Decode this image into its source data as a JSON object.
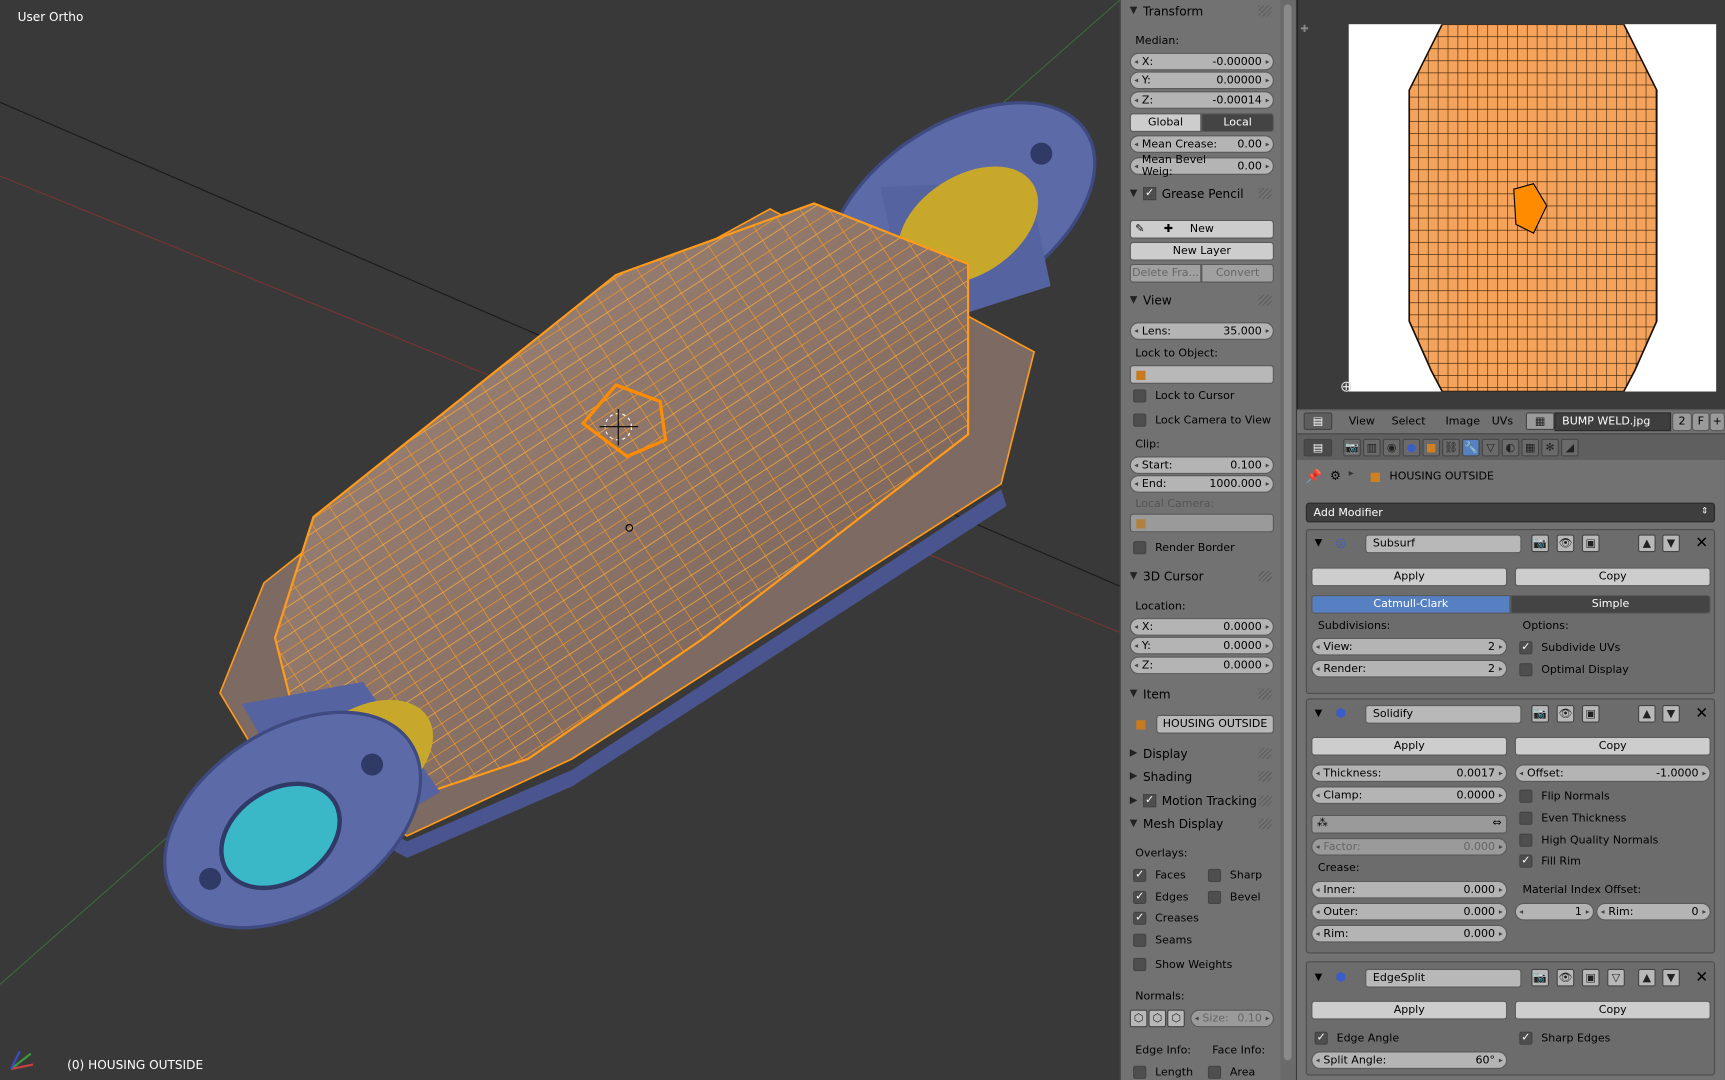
{
  "viewport": {
    "title": "User Ortho",
    "status": "(0) HOUSING OUTSIDE"
  },
  "npanel": {
    "transform": {
      "title": "Transform",
      "median_label": "Median:",
      "x_label": "X:",
      "x": "-0.00000",
      "y_label": "Y:",
      "y": "0.00000",
      "z_label": "Z:",
      "z": "-0.00014",
      "global": "Global",
      "local": "Local",
      "crease_label": "Mean Crease:",
      "crease": "0.00",
      "bevel_label": "Mean Bevel Weig:",
      "bevel": "0.00"
    },
    "grease": {
      "title": "Grease Pencil",
      "new": "New",
      "new_layer": "New Layer",
      "delete": "Delete Fra...",
      "convert": "Convert"
    },
    "view": {
      "title": "View",
      "lens_label": "Lens:",
      "lens": "35.000",
      "lock_obj": "Lock to Object:",
      "lock_cursor": "Lock to Cursor",
      "lock_camera": "Lock Camera to View",
      "clip": "Clip:",
      "start_label": "Start:",
      "start": "0.100",
      "end_label": "End:",
      "end": "1000.000",
      "local_camera": "Local Camera:",
      "render_border": "Render Border"
    },
    "cursor": {
      "title": "3D Cursor",
      "location": "Location:",
      "x_label": "X:",
      "x": "0.0000",
      "y_label": "Y:",
      "y": "0.0000",
      "z_label": "Z:",
      "z": "0.0000"
    },
    "item": {
      "title": "Item",
      "name": "HOUSING OUTSIDE"
    },
    "display": "Display",
    "shading": "Shading",
    "motion": "Motion Tracking",
    "mesh": {
      "title": "Mesh Display",
      "overlays": "Overlays:",
      "faces": "Faces",
      "sharp": "Sharp",
      "edges": "Edges",
      "bevel": "Bevel",
      "creases": "Creases",
      "seams": "Seams",
      "weights": "Show Weights",
      "normals": "Normals:",
      "size_label": "Size:",
      "size": "0.10",
      "edge_info": "Edge Info:",
      "face_info": "Face Info:",
      "length": "Length",
      "area": "Area"
    }
  },
  "image_editor": {
    "menu": [
      "View",
      "Select",
      "Image",
      "UVs"
    ],
    "image_name": "BUMP WELD.jpg",
    "users": "2",
    "fake": "F"
  },
  "props": {
    "object": "HOUSING OUTSIDE",
    "add_modifier": "Add Modifier",
    "subsurf": {
      "name": "Subsurf",
      "apply": "Apply",
      "copy": "Copy",
      "catmull": "Catmull-Clark",
      "simple": "Simple",
      "subdivisions": "Subdivisions:",
      "view_label": "View:",
      "view": "2",
      "render_label": "Render:",
      "render": "2",
      "options": "Options:",
      "subdivide_uvs": "Subdivide UVs",
      "optimal": "Optimal Display"
    },
    "solidify": {
      "name": "Solidify",
      "apply": "Apply",
      "copy": "Copy",
      "thickness_label": "Thickness:",
      "thickness": "0.0017",
      "offset_label": "Offset:",
      "offset": "-1.0000",
      "clamp_label": "Clamp:",
      "clamp": "0.0000",
      "flip": "Flip Normals",
      "even": "Even Thickness",
      "hq": "High Quality Normals",
      "fill_rim": "Fill Rim",
      "factor_label": "Factor:",
      "factor": "0.000",
      "crease": "Crease:",
      "inner_label": "Inner:",
      "inner": "0.000",
      "outer_label": "Outer:",
      "outer": "0.000",
      "rim_label": "Rim:",
      "rim": "0.000",
      "mat_offset": "Material Index Offset:",
      "mat_val": "1",
      "mat_rim_label": "Rim:",
      "mat_rim": "0"
    },
    "edgesplit": {
      "name": "EdgeSplit",
      "apply": "Apply",
      "copy": "Copy",
      "edge_angle": "Edge Angle",
      "sharp_edges": "Sharp Edges",
      "split_label": "Split Angle:",
      "split": "60°"
    }
  }
}
